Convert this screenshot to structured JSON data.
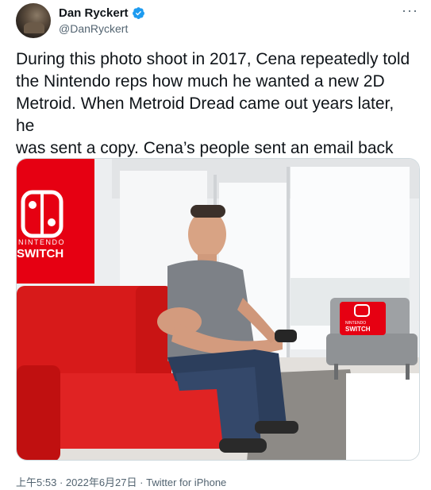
{
  "author": {
    "display_name": "Dan Ryckert",
    "handle": "@DanRyckert",
    "verified": true
  },
  "menu_icon": "more-dots-icon",
  "tweet": {
    "text": "During this photo shoot in 2017, Cena repeatedly told\nthe Nintendo reps how much he wanted a new 2D\nMetroid. When Metroid Dread came out years later, he\nwas sent a copy. Cena’s people sent an email back\nsaying “John loves it.”",
    "time": "上午5:53",
    "separator": "·",
    "date": "2022年6月27日",
    "source": "Twitter for iPhone"
  },
  "media": {
    "sign_text_top": "NINTENDO",
    "sign_text_bottom": "SWITCH",
    "pillow_text_top": "NINTENDO",
    "pillow_text_bottom": "SWITCH"
  },
  "colors": {
    "nintendo_red": "#e60012",
    "verified_blue": "#1d9bf0",
    "text_primary": "#0f1419",
    "text_secondary": "#536471"
  }
}
